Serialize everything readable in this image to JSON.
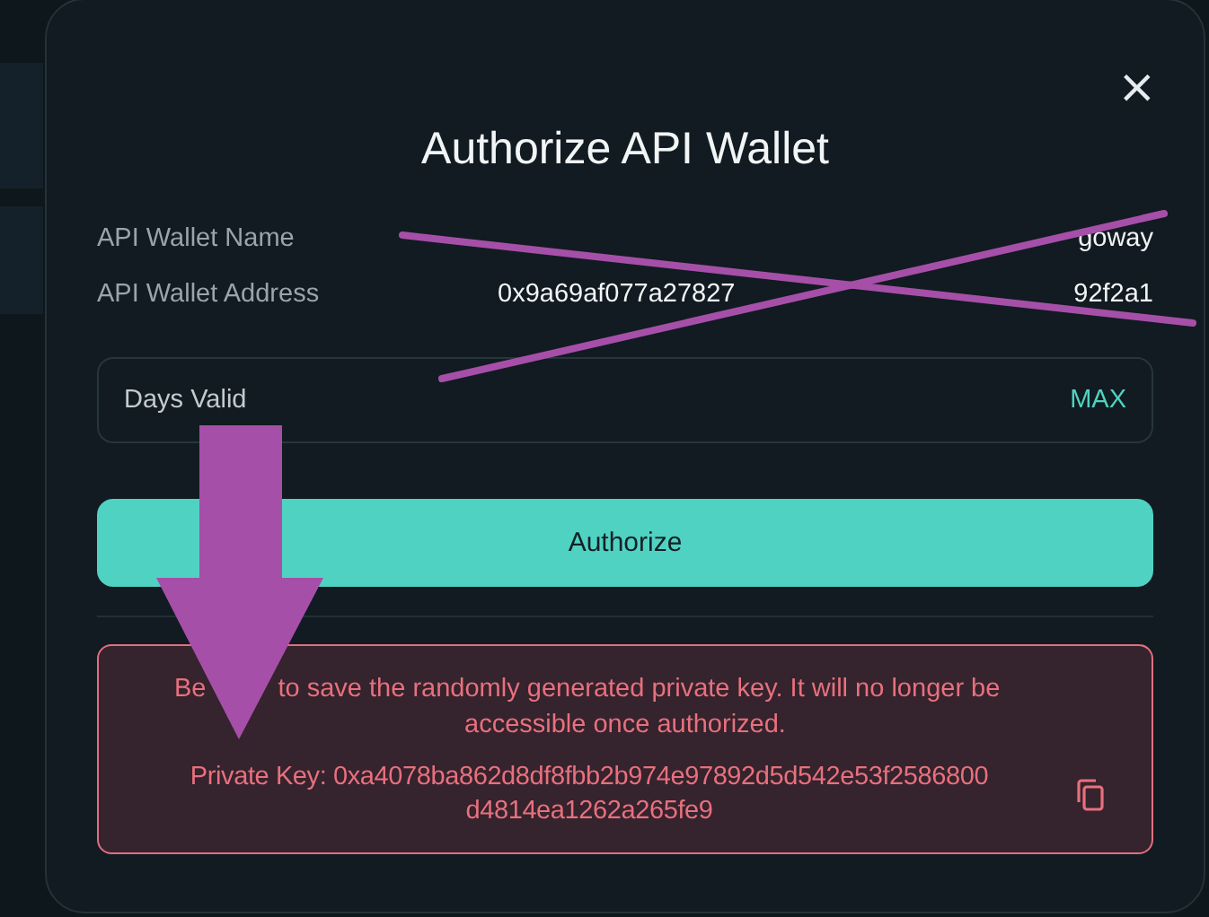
{
  "dialog": {
    "title": "Authorize API Wallet",
    "close_icon": "×",
    "details": [
      {
        "label": "API Wallet Name",
        "value_parts": [
          "goway"
        ]
      },
      {
        "label": "API Wallet Address",
        "value_parts": [
          "0x9a69af077a27827",
          "92f2a1"
        ]
      }
    ],
    "days_field": {
      "placeholder": "Days Valid",
      "max_label": "MAX"
    },
    "authorize_button": "Authorize",
    "warning": {
      "message_parts": [
        "Be",
        "to save the randomly generated private key. It will no longer be",
        "accessible once authorized."
      ],
      "private_key": "Private Key: 0xa4078ba862d8df8fbb2b974e97892d5d542e53f2586800 d4814ea1262a265fe9"
    }
  }
}
